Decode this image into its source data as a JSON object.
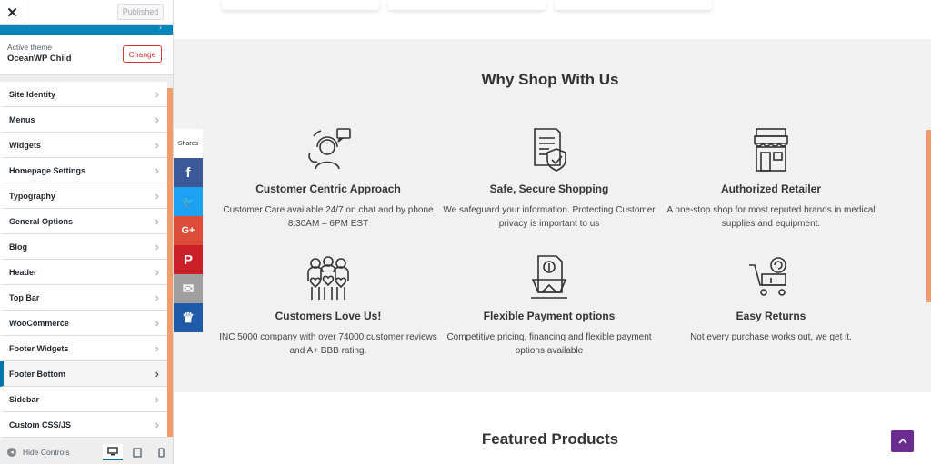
{
  "customizer": {
    "close_glyph": "✕",
    "published_label": "Published",
    "active_theme_label": "Active theme",
    "active_theme_name": "OceanWP Child",
    "change_label": "Change",
    "menu_items": [
      {
        "label": "Site Identity"
      },
      {
        "label": "Menus"
      },
      {
        "label": "Widgets"
      },
      {
        "label": "Homepage Settings"
      },
      {
        "label": "Typography"
      },
      {
        "label": "General Options"
      },
      {
        "label": "Blog"
      },
      {
        "label": "Header"
      },
      {
        "label": "Top Bar"
      },
      {
        "label": "WooCommerce"
      },
      {
        "label": "Footer Widgets"
      },
      {
        "label": "Footer Bottom"
      },
      {
        "label": "Sidebar"
      },
      {
        "label": "Custom CSS/JS"
      }
    ],
    "selected_item": "Footer Bottom",
    "hide_controls_label": "Hide Controls",
    "preview_device": "desktop"
  },
  "preview": {
    "why_title": "Why Shop With Us",
    "features": [
      {
        "title": "Customer Centric Approach",
        "desc": "Customer Care available 24/7 on chat and by phone 8:30AM – 6PM EST",
        "icon": "customer-support-icon"
      },
      {
        "title": "Safe, Secure Shopping",
        "desc": "We safeguard your information. Protecting Customer privacy is important to us",
        "icon": "secure-document-icon"
      },
      {
        "title": "Authorized Retailer",
        "desc": "A one-stop shop for most reputed brands in medical supplies and equipment.",
        "icon": "storefront-icon"
      },
      {
        "title": "Customers Love Us!",
        "desc": "INC 5000 company with over 74000 customer reviews and A+ BBB rating.",
        "icon": "happy-customers-icon"
      },
      {
        "title": "Flexible Payment options",
        "desc": "Competitive pricing, financing and flexible payment options available",
        "icon": "payment-options-icon"
      },
      {
        "title": "Easy Returns",
        "desc": "Not every purchase works out, we get it.",
        "icon": "return-cart-icon"
      }
    ],
    "featured_title": "Featured Products",
    "share_label": "Shares",
    "share_buttons": [
      {
        "network": "facebook",
        "glyph": "f",
        "color": "#3b5998"
      },
      {
        "network": "twitter",
        "glyph": "🐦",
        "color": "#1da1f2"
      },
      {
        "network": "google-plus",
        "glyph": "G+",
        "color": "#dd4b39"
      },
      {
        "network": "pinterest",
        "glyph": "P",
        "color": "#cb2027"
      },
      {
        "network": "email",
        "glyph": "✉",
        "color": "#a0a0a0"
      },
      {
        "network": "sumo",
        "glyph": "♛",
        "color": "#1f5aa8"
      }
    ]
  },
  "colors": {
    "accent_orange": "#f39c6b",
    "wp_blue": "#0085ba",
    "to_top_purple": "#6a2c91"
  }
}
